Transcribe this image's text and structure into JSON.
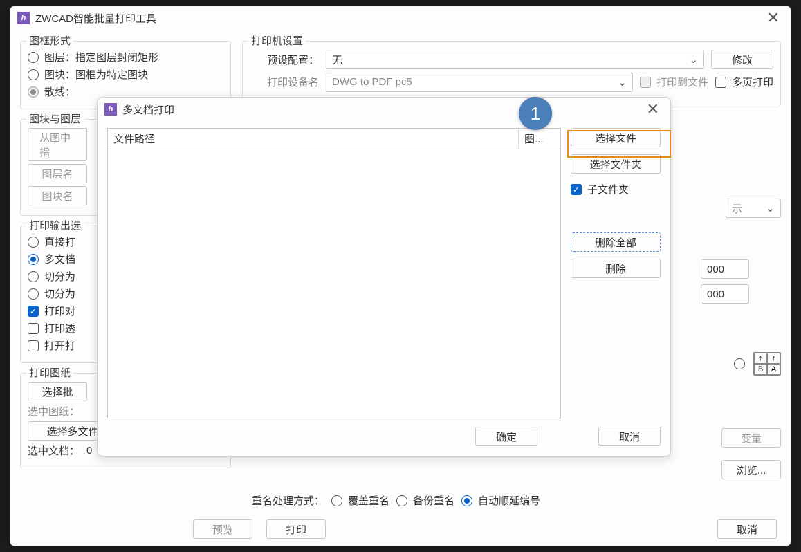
{
  "main": {
    "title": "ZWCAD智能批量打印工具",
    "group_frame": {
      "title": "图框形式",
      "opt_layer": "图层：指定图层封闭矩形",
      "opt_block": "图块：图框为特定图块",
      "opt_scatter_prefix": "散线："
    },
    "group_blocklayer": {
      "title": "图块与图层",
      "btn_pick": "从图中指",
      "btn_layer": "图层名",
      "btn_block": "图块名"
    },
    "group_output": {
      "title": "打印输出选",
      "opt_direct": "直接打",
      "opt_multi": "多文档",
      "opt_split1": "切分为",
      "opt_split2": "切分为",
      "chk_frame": "打印对",
      "chk_trans": "打印透",
      "chk_open": "打开打"
    },
    "group_sheets": {
      "title": "打印图纸",
      "btn_select_batch": "选择批",
      "lbl_selected": "选中图纸：",
      "btn_select_multi": "选择多文件",
      "lbl_selected_docs": "选中文档：",
      "val_selected_docs": "0"
    },
    "printer": {
      "title": "打印机设置",
      "lbl_preset": "预设配置：",
      "val_preset": "无",
      "btn_modify": "修改",
      "lbl_device": "打印设备名",
      "val_device": "DWG to PDF pc5",
      "chk_print_to_file": "打印到文件",
      "chk_multipage": "多页打印"
    },
    "midnums": {
      "v1": "000",
      "v2": "000"
    },
    "pagesort": {
      "radio_sort": "",
      "cell_a": "↑A",
      "cell_b": "↑A",
      "cell_c": "B",
      "cell_d": "A"
    },
    "rightside": {
      "select_hint": "示",
      "btn_var": "变量",
      "btn_browse": "浏览..."
    },
    "rename": {
      "label": "重名处理方式：",
      "opt_over": "覆盖重名",
      "opt_backup": "备份重名",
      "opt_auto": "自动顺延编号"
    },
    "footer": {
      "btn_preview": "预览",
      "btn_print": "打印",
      "btn_cancel": "取消"
    }
  },
  "dialog": {
    "title": "多文档打印",
    "th_path": "文件路径",
    "th_layer": "图...",
    "btn_select_file": "选择文件",
    "btn_select_folder": "选择文件夹",
    "chk_subfolder": "子文件夹",
    "btn_delete_all": "删除全部",
    "btn_delete": "删除",
    "btn_ok": "确定",
    "btn_cancel": "取消"
  },
  "annotation": {
    "step1": "1"
  }
}
